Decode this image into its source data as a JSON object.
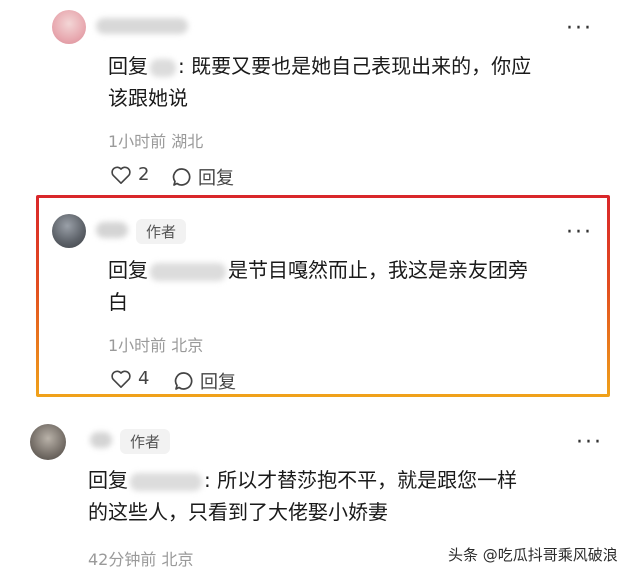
{
  "comments": [
    {
      "reply_prefix": "回复",
      "text_line1": ": 既要又要也是她自己表现出来的，你应",
      "text_line2": "该跟她说",
      "time": "1小时前",
      "location": "湖北",
      "likes": "2",
      "reply_label": "回复"
    },
    {
      "author_tag": "作者",
      "reply_prefix": "回复",
      "text_line1": "是节目嘎然而止，我这是亲友团旁",
      "text_line2": "白",
      "time": "1小时前",
      "location": "北京",
      "likes": "4",
      "reply_label": "回复"
    },
    {
      "author_tag": "作者",
      "reply_prefix": "回复",
      "text_line1": ": 所以才替莎抱不平，就是跟您一样",
      "text_line2": "的这些人，只看到了大佬娶小娇妻",
      "time": "42分钟前",
      "location": "北京"
    }
  ],
  "more_glyph": "···",
  "watermark": "头条 @吃瓜抖哥乘风破浪",
  "colors": {
    "highlight_top": "#d9262a",
    "highlight_bottom": "#f0a21a"
  }
}
